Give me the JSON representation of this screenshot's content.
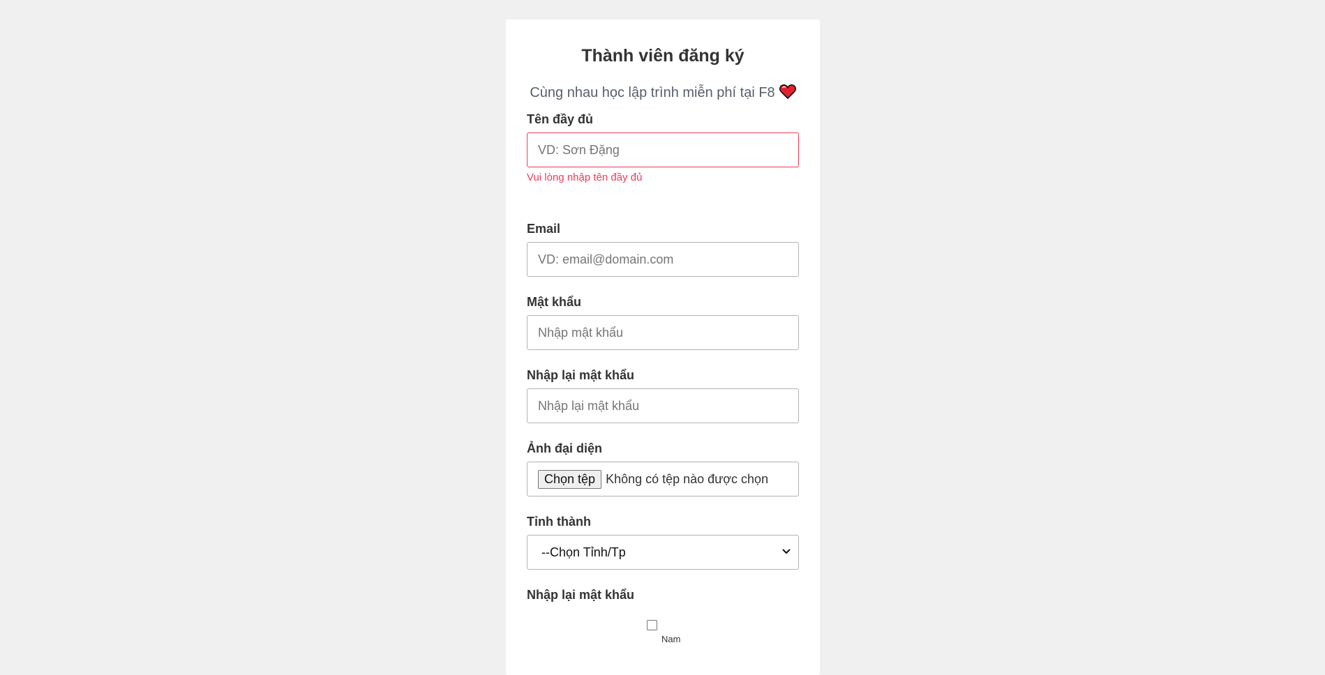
{
  "form": {
    "title": "Thành viên đăng ký",
    "subtitle": "Cùng nhau học lập trình miễn phí tại F8",
    "heart_icon": "heart-icon",
    "fullname": {
      "label": "Tên đầy đủ",
      "placeholder": "VD: Sơn Đặng",
      "value": "",
      "error": "Vui lòng nhập tên đầy đủ"
    },
    "email": {
      "label": "Email",
      "placeholder": "VD: email@domain.com",
      "value": ""
    },
    "password": {
      "label": "Mật khẩu",
      "placeholder": "Nhập mật khẩu",
      "value": ""
    },
    "password_confirm": {
      "label": "Nhập lại mật khẩu",
      "placeholder": "Nhập lại mật khẩu",
      "value": ""
    },
    "avatar": {
      "label": "Ảnh đại diện",
      "button_label": "Chọn tệp",
      "status": "Không có tệp nào được chọn"
    },
    "province": {
      "label": "Tỉnh thành",
      "selected": "--Chọn Tỉnh/Tp"
    },
    "gender": {
      "label": "Nhập lại mật khẩu",
      "option_label": "Nam",
      "checked": false
    }
  },
  "colors": {
    "background": "#f0f0f0",
    "card": "#ffffff",
    "error": "#f33a58",
    "heart": "#e5202e"
  }
}
